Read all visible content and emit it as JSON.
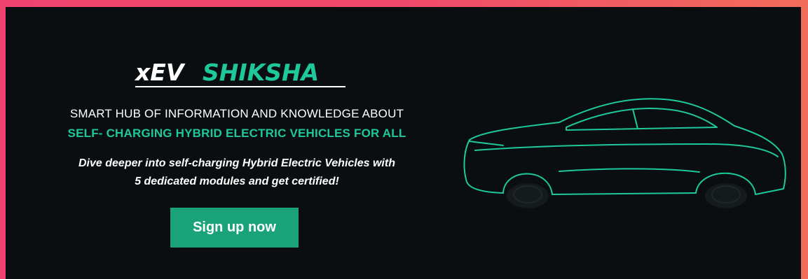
{
  "brand": {
    "logo_prefix": "xEV",
    "logo_suffix": "SHIKSHA",
    "accent_color": "#1fc89a",
    "button_color": "#1aa278",
    "frame_gradient": [
      "#f0426e",
      "#f26c5a"
    ]
  },
  "headline": "SMART HUB OF INFORMATION AND KNOWLEDGE ABOUT",
  "subheadline": "SELF- CHARGING HYBRID ELECTRIC VEHICLES FOR ALL",
  "description": {
    "line1": "Dive deeper into self-charging Hybrid Electric Vehicles with",
    "line2": "5 dedicated modules and get certified!"
  },
  "cta": {
    "label": "Sign up now"
  },
  "illustration": {
    "icon": "car-outline-icon"
  }
}
